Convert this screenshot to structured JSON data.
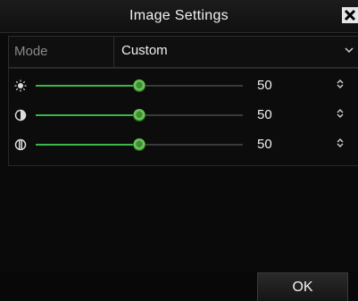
{
  "dialog": {
    "title": "Image Settings",
    "close_glyph": "✕"
  },
  "mode": {
    "label": "Mode",
    "value": "Custom",
    "caret": "⌄"
  },
  "sliders": [
    {
      "icon": "brightness-icon",
      "value": "50",
      "level": 0.5
    },
    {
      "icon": "contrast-icon",
      "value": "50",
      "level": 0.5
    },
    {
      "icon": "saturation-icon",
      "value": "50",
      "level": 0.5
    }
  ],
  "spinner_glyph": "⌃⌄",
  "footer": {
    "ok_label": "OK"
  },
  "colors": {
    "accent": "#3cb54a",
    "background": "#0a0a0a"
  }
}
